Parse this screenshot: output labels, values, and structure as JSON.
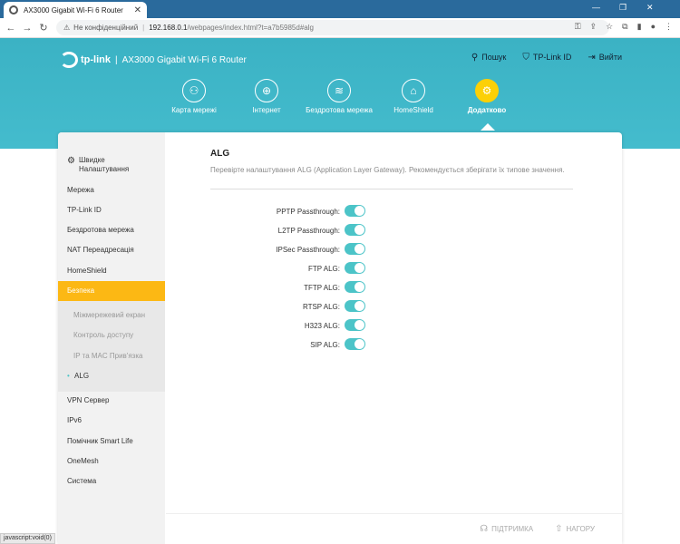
{
  "browser": {
    "tab_title": "AX3000 Gigabit Wi-Fi 6 Router",
    "not_secure": "Не конфіденційний",
    "url_host": "192.168.0.1",
    "url_rest": "/webpages/index.html?t=a7b5985d#alg"
  },
  "header": {
    "brand": "tp-link",
    "model": "AX3000 Gigabit Wi-Fi 6 Router",
    "search": "Пошук",
    "tplink_id": "TP-Link ID",
    "logout": "Вийти"
  },
  "nav": [
    {
      "label": "Карта мережі",
      "icon": "network-map-icon"
    },
    {
      "label": "Інтернет",
      "icon": "globe-icon"
    },
    {
      "label": "Бездротова мережа",
      "icon": "wifi-icon"
    },
    {
      "label": "HomeShield",
      "icon": "home-shield-icon"
    },
    {
      "label": "Додатково",
      "icon": "gear-icon"
    }
  ],
  "sidebar": {
    "quick_setup": "Швидке Налаштування",
    "items": [
      "Мережа",
      "TP-Link ID",
      "Бездротова мережа",
      "NAT Переадресація",
      "HomeShield",
      "Безпека"
    ],
    "sub_items": [
      "Міжмережевий екран",
      "Контроль доступу",
      "IP та MAC Прив'язка",
      "ALG"
    ],
    "items_after": [
      "VPN Сервер",
      "IPv6",
      "Помічник Smart Life",
      "OneMesh",
      "Система"
    ]
  },
  "main": {
    "title": "ALG",
    "description": "Перевірте налаштування ALG (Application Layer Gateway). Рекомендується зберігати їх типове значення.",
    "rows": [
      {
        "label": "PPTP Passthrough:",
        "on": true
      },
      {
        "label": "L2TP Passthrough:",
        "on": true
      },
      {
        "label": "IPSec Passthrough:",
        "on": true
      },
      {
        "label": "FTP ALG:",
        "on": true
      },
      {
        "label": "TFTP ALG:",
        "on": true
      },
      {
        "label": "RTSP ALG:",
        "on": true
      },
      {
        "label": "H323 ALG:",
        "on": true
      },
      {
        "label": "SIP ALG:",
        "on": true
      }
    ]
  },
  "footer": {
    "support": "ПІДТРИМКА",
    "top": "НАГОРУ"
  },
  "status_bar": "javascript:void(0)",
  "colors": {
    "accent": "#fcb814",
    "header": "#44bccd",
    "toggle": "#4cc4c8"
  }
}
